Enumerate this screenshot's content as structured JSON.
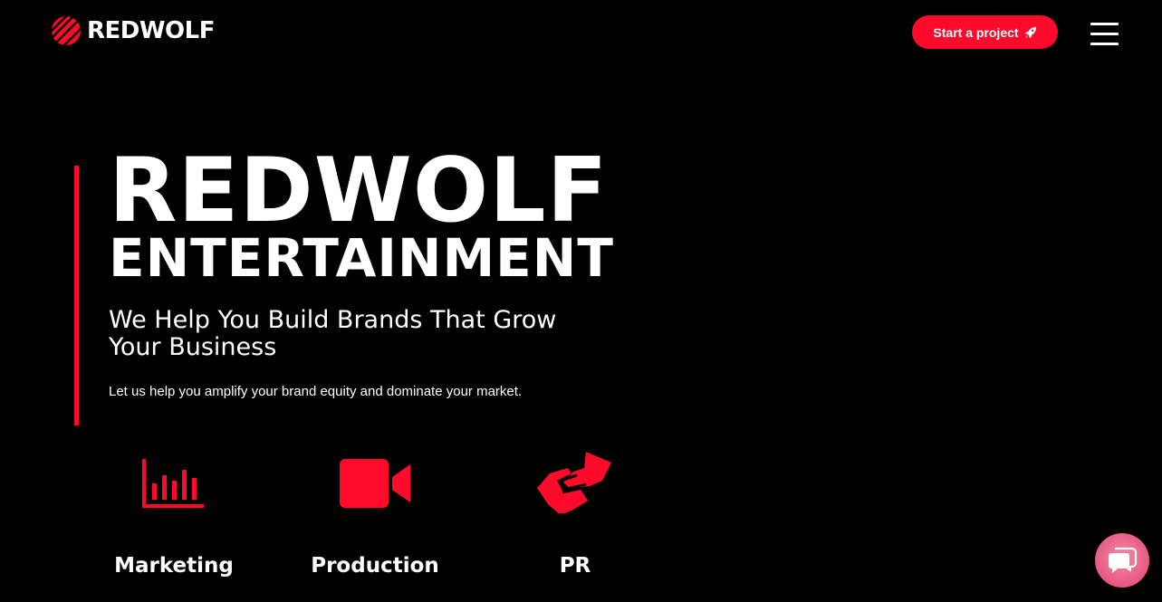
{
  "header": {
    "logo_text": "REDWOLF",
    "cta_label": "Start a project",
    "cta_icon": "rocket-icon",
    "menu_icon": "hamburger-menu-icon"
  },
  "hero": {
    "title": "REDWOLF",
    "subtitle": "ENTERTAINMENT",
    "tagline": "We Help You Build Brands That Grow Your Business",
    "description": "Let us help you amplify your brand equity and dominate your market."
  },
  "services": [
    {
      "label": "Marketing",
      "icon": "bar-chart-icon"
    },
    {
      "label": "Production",
      "icon": "video-camera-icon"
    },
    {
      "label": "PR",
      "icon": "handshake-icon"
    }
  ],
  "chat": {
    "icon": "chat-bubbles-icon"
  },
  "colors": {
    "background": "#000000",
    "accent": "#ff0a2a",
    "text": "#ffffff",
    "chat_button": "#e8577f"
  }
}
